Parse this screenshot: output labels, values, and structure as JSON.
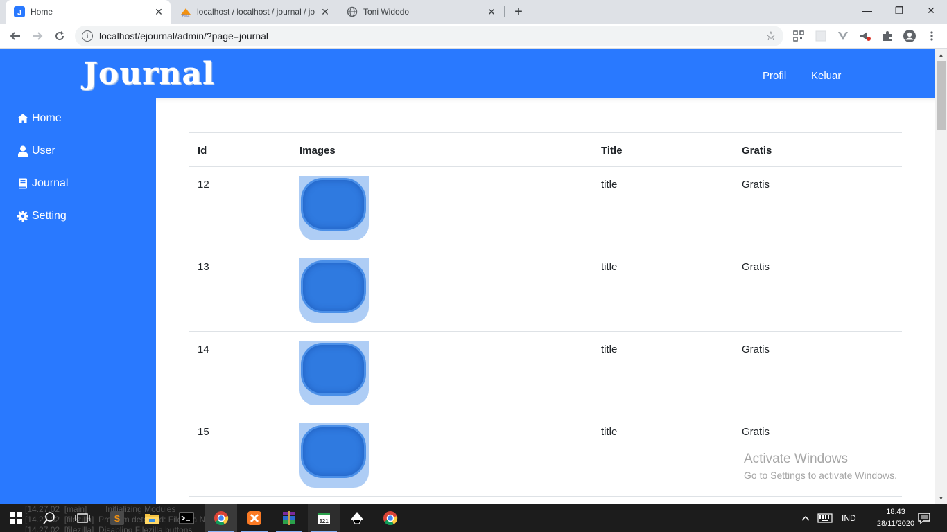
{
  "browser": {
    "tabs": [
      {
        "title": "Home",
        "active": true
      },
      {
        "title": "localhost / localhost / journal / jo",
        "active": false
      },
      {
        "title": "Toni Widodo",
        "active": false
      }
    ],
    "url": "localhost/ejournal/admin/?page=journal",
    "new_tab": "+",
    "window_controls": {
      "minimize": "—",
      "restore": "❐",
      "close": "✕"
    }
  },
  "header": {
    "logo": "Journal",
    "links": [
      "Profil",
      "Keluar"
    ]
  },
  "sidebar": {
    "items": [
      {
        "label": "Home",
        "icon": "home-icon"
      },
      {
        "label": "User",
        "icon": "user-icon"
      },
      {
        "label": "Journal",
        "icon": "book-icon"
      },
      {
        "label": "Setting",
        "icon": "gear-icon"
      }
    ]
  },
  "table": {
    "headers": [
      "Id",
      "Images",
      "Title",
      "Gratis"
    ],
    "rows": [
      {
        "id": "12",
        "title": "title",
        "gratis": "Gratis"
      },
      {
        "id": "13",
        "title": "title",
        "gratis": "Gratis"
      },
      {
        "id": "14",
        "title": "title",
        "gratis": "Gratis"
      },
      {
        "id": "15",
        "title": "title",
        "gratis": "Gratis"
      }
    ]
  },
  "watermark": {
    "line1": "Activate Windows",
    "line2": "Go to Settings to activate Windows."
  },
  "taskbar": {
    "log_lines": [
      "[14.27.02  [main]        Initializing Modules",
      "[14.27.02  [filezilla]  Problem detected: FileZilla Not found",
      "[14.27.02  [filezilla]  Disabling Filezilla buttons"
    ],
    "language": "IND",
    "time": "18.43",
    "date": "28/11/2020"
  },
  "colors": {
    "brand_blue": "#2979ff"
  }
}
